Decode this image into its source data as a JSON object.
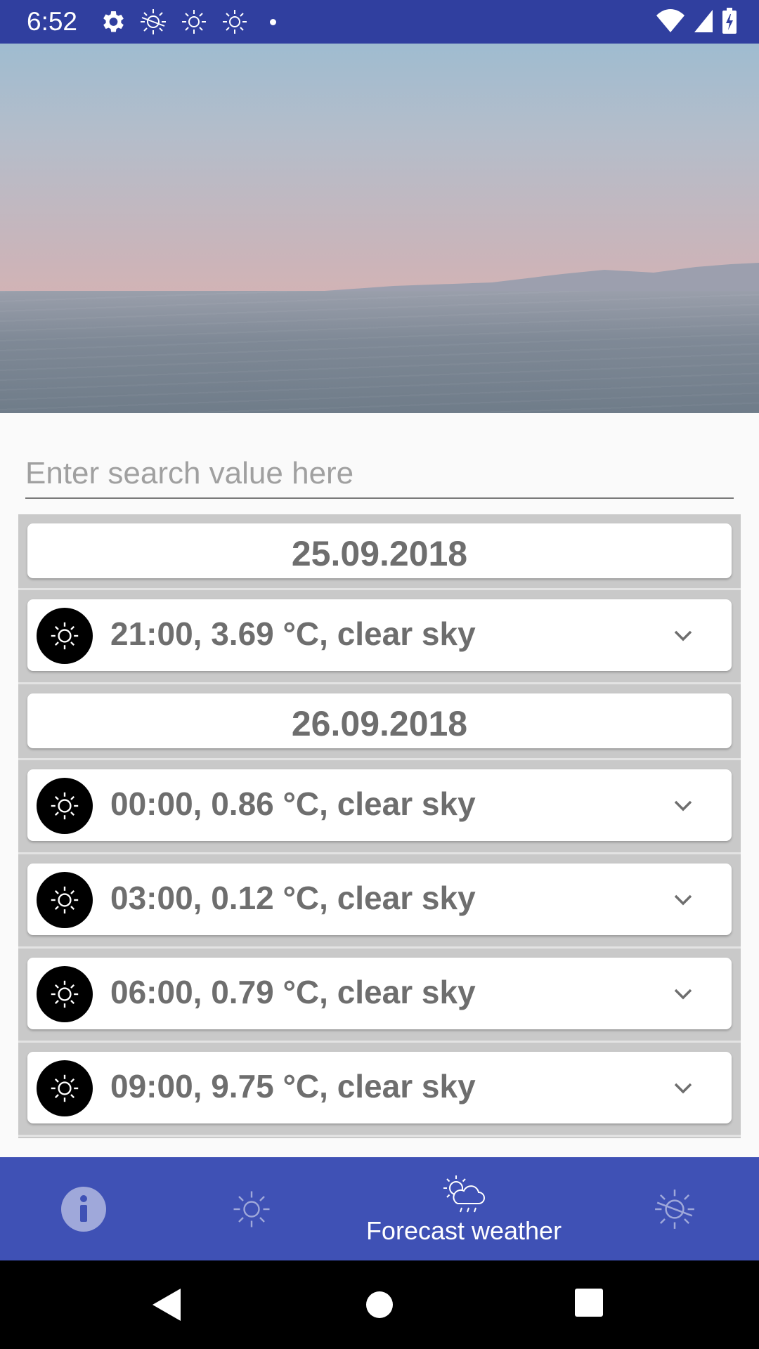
{
  "status_bar": {
    "time": "6:52",
    "left_icons": [
      "settings-icon",
      "sun-crossed-icon",
      "sun-icon",
      "sun-icon",
      "notification-dot"
    ],
    "right_icons": [
      "wifi-icon",
      "signal-icon",
      "battery-charging-icon"
    ]
  },
  "search": {
    "placeholder": "Enter search value here",
    "value": ""
  },
  "forecast_list": {
    "groups": [
      {
        "date": "25.09.2018",
        "rows": [
          {
            "text": "21:00, 3.69 °C, clear sky",
            "icon": "clear-sky-icon"
          }
        ]
      },
      {
        "date": "26.09.2018",
        "rows": [
          {
            "text": "00:00, 0.86 °C, clear sky",
            "icon": "clear-sky-icon"
          },
          {
            "text": "03:00, 0.12 °C, clear sky",
            "icon": "clear-sky-icon"
          },
          {
            "text": "06:00, 0.79 °C, clear sky",
            "icon": "clear-sky-icon"
          },
          {
            "text": "09:00, 9.75 °C, clear sky",
            "icon": "clear-sky-icon"
          }
        ]
      }
    ]
  },
  "bottom_nav": {
    "items": [
      {
        "icon": "info-icon",
        "label": "",
        "active": false
      },
      {
        "icon": "sun-icon",
        "label": "",
        "active": false
      },
      {
        "icon": "sun-cloud-icon",
        "label": "Forecast weather",
        "active": true
      },
      {
        "icon": "sun-crossed-icon",
        "label": "",
        "active": false
      }
    ]
  },
  "colors": {
    "status_bar": "#303f9f",
    "bottom_nav": "#3f51b5",
    "list_background": "#c9c9c9",
    "card_text": "#6e6e6e"
  }
}
